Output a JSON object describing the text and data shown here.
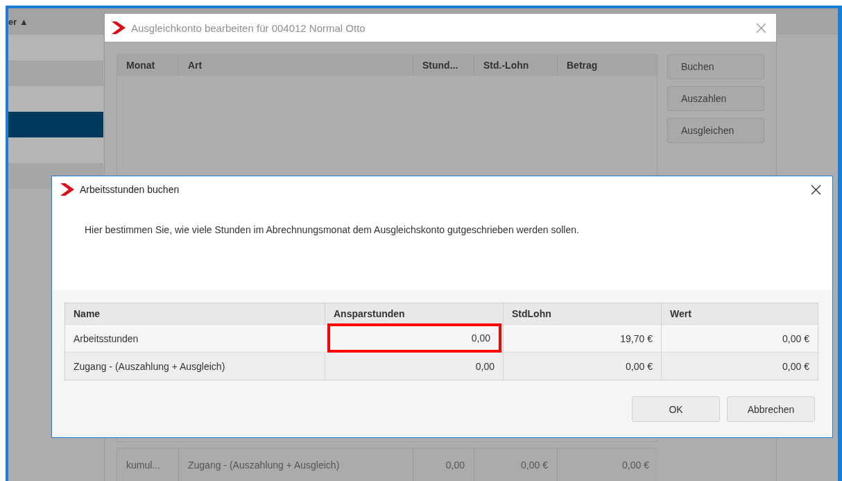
{
  "background_list": {
    "header": "er ▲",
    "rows": [
      {
        "selected": false
      },
      {
        "selected": false
      },
      {
        "selected": false
      },
      {
        "selected": true
      },
      {
        "selected": false
      },
      {
        "selected": false
      }
    ]
  },
  "account_window": {
    "title": "Ausgleichkonto bearbeiten für 004012 Normal Otto",
    "columns": [
      "Monat",
      "Art",
      "Stund...",
      "Std.-Lohn",
      "Betrag"
    ],
    "buttons": [
      "Buchen",
      "Auszahlen",
      "Ausgleichen"
    ],
    "summary_rows": [
      {
        "cells": [
          "kumul...",
          "Zugang - (Auszahlung + Ausgleich)",
          "0,00",
          "0,00 €",
          "0,00 €"
        ]
      }
    ]
  },
  "booking_dialog": {
    "title": "Arbeitsstunden buchen",
    "description": "Hier bestimmen Sie, wie viele Stunden im Abrechnungsmonat dem Ausgleichskonto gutgeschrieben werden sollen.",
    "columns": [
      "Name",
      "Ansparstunden",
      "StdLohn",
      "Wert"
    ],
    "rows": [
      {
        "cells": [
          "Arbeitsstunden",
          "0,00",
          "19,70 €",
          "0,00 €"
        ],
        "editing": true
      },
      {
        "cells": [
          "Zugang - (Auszahlung + Ausgleich)",
          "0,00",
          "0,00 €",
          "0,00 €"
        ],
        "editing": false
      }
    ],
    "buttons": [
      "OK",
      "Abbrechen"
    ]
  }
}
